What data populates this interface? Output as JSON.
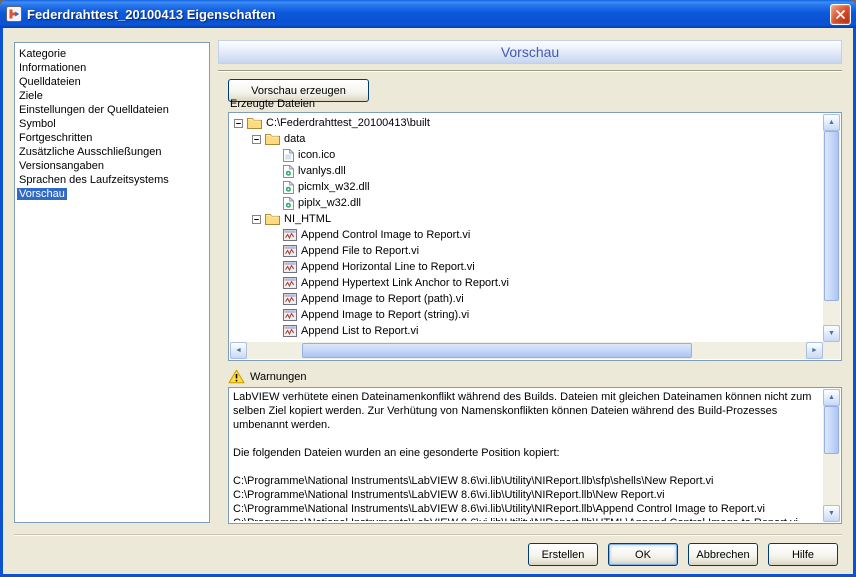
{
  "window": {
    "title": "Federdrahttest_20100413 Eigenschaften"
  },
  "icons": {
    "scroll_up": "▲",
    "scroll_down": "▼",
    "scroll_left": "◄",
    "scroll_right": "►"
  },
  "sidebar": {
    "label": "Kategorie",
    "items": [
      {
        "label": "Informationen",
        "selected": false
      },
      {
        "label": "Quelldateien",
        "selected": false
      },
      {
        "label": "Ziele",
        "selected": false
      },
      {
        "label": "Einstellungen der Quelldateien",
        "selected": false
      },
      {
        "label": "Symbol",
        "selected": false
      },
      {
        "label": "Fortgeschritten",
        "selected": false
      },
      {
        "label": "Zusätzliche Ausschließungen",
        "selected": false
      },
      {
        "label": "Versionsangaben",
        "selected": false
      },
      {
        "label": "Sprachen des Laufzeitsystems",
        "selected": false
      },
      {
        "label": "Vorschau",
        "selected": true
      }
    ]
  },
  "main": {
    "header": "Vorschau",
    "generate_button": "Vorschau erzeugen",
    "files_group": {
      "label": "Erzeugte Dateien",
      "tree": [
        {
          "level": 0,
          "icon": "folder",
          "expandable": true,
          "label": "C:\\Federdrahttest_20100413\\built"
        },
        {
          "level": 1,
          "icon": "folder",
          "expandable": true,
          "label": "data"
        },
        {
          "level": 2,
          "icon": "file",
          "expandable": false,
          "label": "icon.ico"
        },
        {
          "level": 2,
          "icon": "dll",
          "expandable": false,
          "label": "lvanlys.dll"
        },
        {
          "level": 2,
          "icon": "dll",
          "expandable": false,
          "label": "picmlx_w32.dll"
        },
        {
          "level": 2,
          "icon": "dll",
          "expandable": false,
          "label": "piplx_w32.dll"
        },
        {
          "level": 1,
          "icon": "folder",
          "expandable": true,
          "label": "NI_HTML"
        },
        {
          "level": 2,
          "icon": "vi",
          "expandable": false,
          "label": "Append Control Image to Report.vi"
        },
        {
          "level": 2,
          "icon": "vi",
          "expandable": false,
          "label": "Append File to Report.vi"
        },
        {
          "level": 2,
          "icon": "vi",
          "expandable": false,
          "label": "Append Horizontal Line to Report.vi"
        },
        {
          "level": 2,
          "icon": "vi",
          "expandable": false,
          "label": "Append Hypertext Link Anchor to Report.vi"
        },
        {
          "level": 2,
          "icon": "vi",
          "expandable": false,
          "label": "Append Image to Report (path).vi"
        },
        {
          "level": 2,
          "icon": "vi",
          "expandable": false,
          "label": "Append Image to Report (string).vi"
        },
        {
          "level": 2,
          "icon": "vi",
          "expandable": false,
          "label": "Append List to Report.vi"
        }
      ]
    },
    "warnings": {
      "label": "Warnungen",
      "text": "LabVIEW verhütete einen Dateinamenkonflikt während des Builds. Dateien mit gleichen Dateinamen können nicht zum selben Ziel kopiert werden. Zur Verhütung von Namenskonflikten können Dateien während des Build-Prozesses umbenannt werden.\n\nDie folgenden Dateien wurden an eine gesonderte Position kopiert:\n\nC:\\Programme\\National Instruments\\LabVIEW 8.6\\vi.lib\\Utility\\NIReport.llb\\sfp\\shells\\New Report.vi\nC:\\Programme\\National Instruments\\LabVIEW 8.6\\vi.lib\\Utility\\NIReport.llb\\New Report.vi\nC:\\Programme\\National Instruments\\LabVIEW 8.6\\vi.lib\\Utility\\NIReport.llb\\Append Control Image to Report.vi\nC:\\Programme\\National Instruments\\LabVIEW 8.6\\vi.lib\\Utility\\NIReport.llb\\HTML\\Append Control Image to Report.vi\nC:\\Programme\\National Instruments\\LabVIEW 8.6\\vi.lib\\Utility\\NIReport.llb\\Append File to Report.vi"
    },
    "footer_buttons": [
      {
        "key": "erstellen",
        "label": "Erstellen",
        "default": false
      },
      {
        "key": "ok",
        "label": "OK",
        "default": true
      },
      {
        "key": "abbrechen",
        "label": "Abbrechen",
        "default": false
      },
      {
        "key": "hilfe",
        "label": "Hilfe",
        "default": false
      }
    ]
  },
  "colors": {
    "dialog_bg": "#ECE9D8",
    "selection": "#316AC5",
    "titlebar_blue": "#0A52D2",
    "banner_text": "#4459B8"
  }
}
